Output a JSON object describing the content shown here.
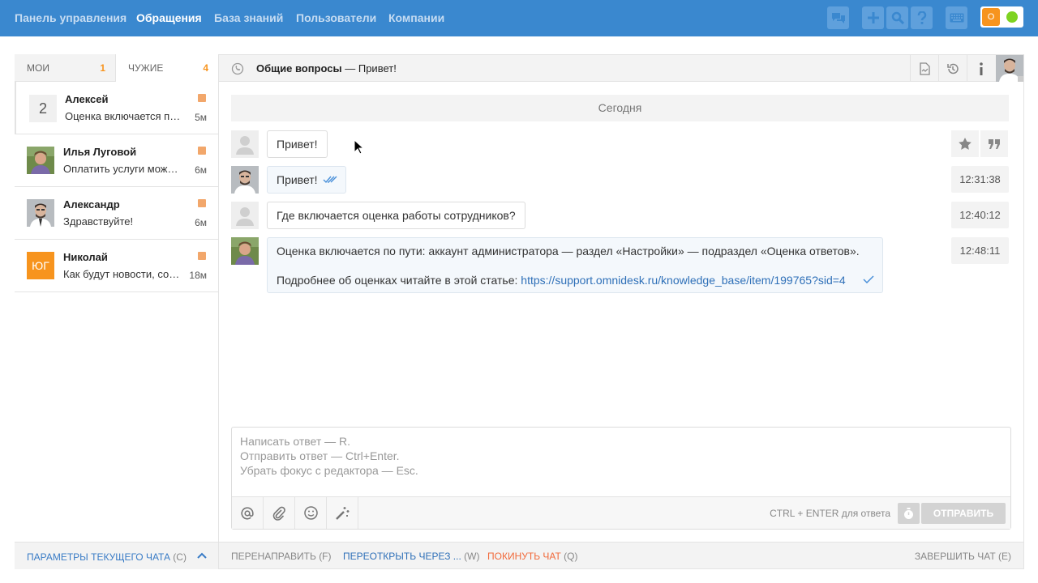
{
  "nav": {
    "items": [
      {
        "label": "Панель управления",
        "active": false
      },
      {
        "label": "Обращения",
        "active": true
      },
      {
        "label": "База знаний",
        "active": false
      },
      {
        "label": "Пользователи",
        "active": false
      },
      {
        "label": "Компании",
        "active": false
      }
    ],
    "status_letter": "O"
  },
  "tabs": {
    "mine_label": "МОИ",
    "mine_count": "1",
    "others_label": "ЧУЖИЕ",
    "others_count": "4"
  },
  "chats": [
    {
      "badge": "2",
      "name": "Алексей",
      "preview": "Оценка включается по пути: аккаунт",
      "time": "5м"
    },
    {
      "name": "Илья Луговой",
      "preview": "Оплатить услуги можно картой",
      "time": "6м"
    },
    {
      "name": "Александр",
      "preview": "Здравствуйте!",
      "time": "6м"
    },
    {
      "avatar_text": "ЮГ",
      "name": "Николай",
      "preview": "Как будут новости, сообщите",
      "time": "18м"
    }
  ],
  "sidebar_footer": {
    "label": "ПАРАМЕТРЫ ТЕКУЩЕГО ЧАТА",
    "key": "(C)"
  },
  "header": {
    "group": "Общие вопросы",
    "dash": "—",
    "subject": "Привет!"
  },
  "date_separator": "Сегодня",
  "messages": [
    {
      "text": "Привет!",
      "time": ""
    },
    {
      "text": "Привет!",
      "time": "12:31:38"
    },
    {
      "text": "Где включается оценка работы сотрудников?",
      "time": "12:40:12"
    },
    {
      "line1": "Оценка включается по пути: аккаунт администратора — раздел «Настройки» — подраздел «Оценка ответов».",
      "line2_prefix": "Подробнее об оценках читайте в этой статье: ",
      "link": "https://support.omnidesk.ru/knowledge_base/item/199765?sid=4",
      "time": "12:48:11"
    }
  ],
  "editor": {
    "placeholder_lines": [
      "Написать ответ — R.",
      "Отправить ответ — Ctrl+Enter.",
      "Убрать фокус с редактора — Esc."
    ],
    "hint": "CTRL + ENTER для ответа",
    "send_label": "ОТПРАВИТЬ"
  },
  "bottom_bar": {
    "redirect": {
      "label": "ПЕРЕНАПРАВИТЬ",
      "key": "(F)"
    },
    "reopen": {
      "label": "ПЕРЕОТКРЫТЬ ЧЕРЕЗ ...",
      "key": "(W)"
    },
    "leave": {
      "label": "ПОКИНУТЬ ЧАТ",
      "key": "(Q)"
    },
    "finish": {
      "label": "ЗАВЕРШИТЬ ЧАТ",
      "key": "(E)"
    }
  },
  "colors": {
    "brand": "#3a88cf",
    "accent": "#f7941e",
    "link": "#2f70b8",
    "online": "#7ed321",
    "leave": "#f26a3b"
  }
}
